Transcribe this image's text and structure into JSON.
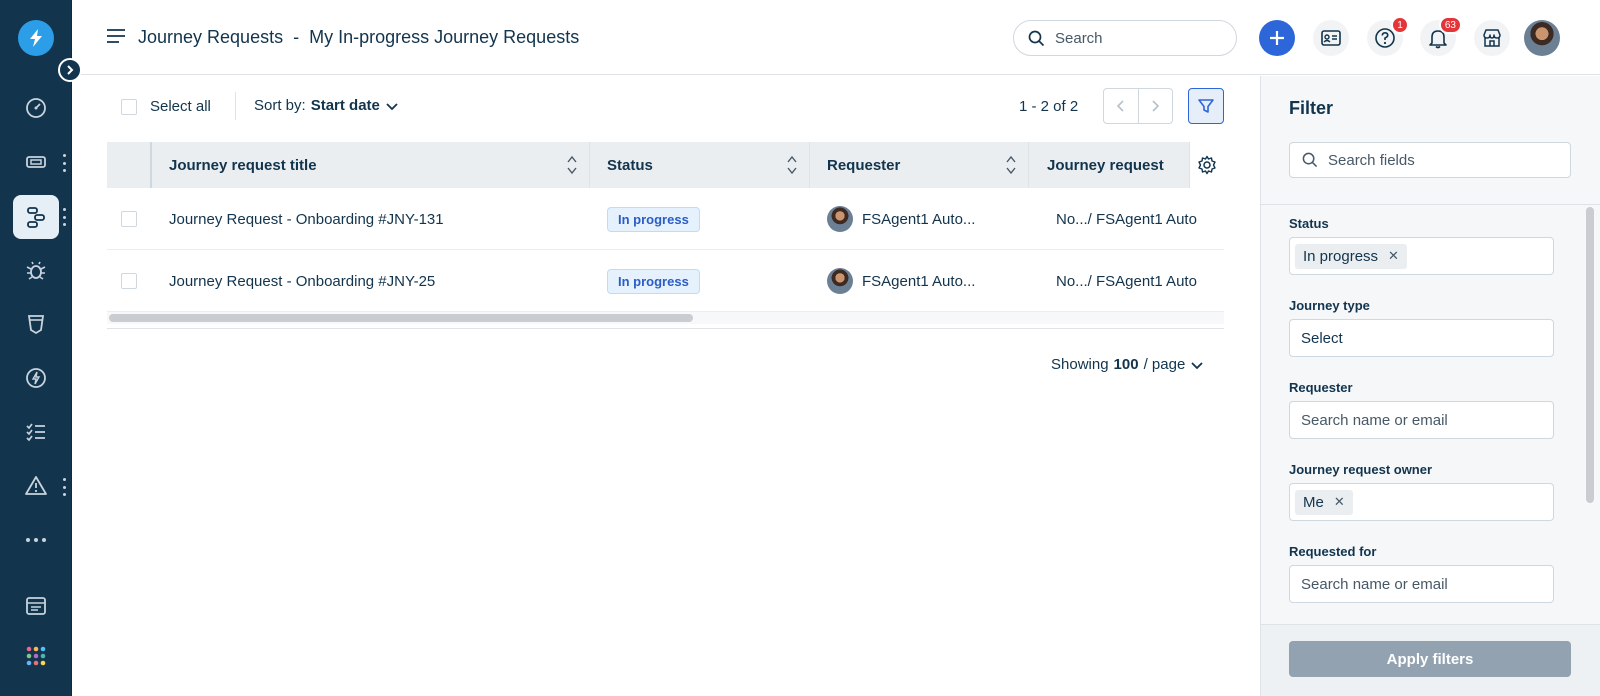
{
  "header": {
    "title": "Journey Requests",
    "separator": "-",
    "subtitle": "My In-progress Journey Requests",
    "search_placeholder": "Search",
    "help_badge": "1",
    "notifications_badge": "63"
  },
  "toolbar": {
    "select_all": "Select all",
    "sort_label": "Sort by:",
    "sort_value": "Start date",
    "pagination": "1 - 2 of 2"
  },
  "table": {
    "columns": [
      "Journey request title",
      "Status",
      "Requester",
      "Journey request"
    ],
    "rows": [
      {
        "title": "Journey Request - Onboarding  #JNY-131",
        "status": "In progress",
        "requester": "FSAgent1 Auto...",
        "owner": "No.../ FSAgent1 Auto"
      },
      {
        "title": "Journey Request - Onboarding  #JNY-25",
        "status": "In progress",
        "requester": "FSAgent1 Auto...",
        "owner": "No.../ FSAgent1 Auto"
      }
    ]
  },
  "footer": {
    "showing_prefix": "Showing",
    "per_page": "100",
    "showing_suffix": "/ page"
  },
  "filter": {
    "title": "Filter",
    "search_placeholder": "Search fields",
    "status_label": "Status",
    "status_chip": "In progress",
    "journey_type_label": "Journey type",
    "journey_type_value": "Select",
    "requester_label": "Requester",
    "requester_placeholder": "Search name or email",
    "owner_label": "Journey request owner",
    "owner_chip": "Me",
    "requested_for_label": "Requested for",
    "requested_for_placeholder": "Search name or email",
    "apply": "Apply filters"
  },
  "colors": {
    "nav_bg": "#12344d",
    "primary": "#2c66d9",
    "status_pill": "#e5f2fd",
    "badge": "#e43538"
  }
}
